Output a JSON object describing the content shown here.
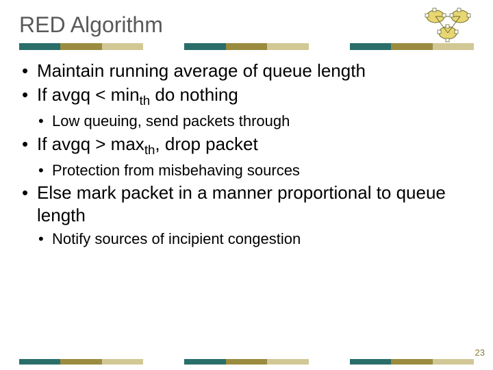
{
  "title": "RED Algorithm",
  "bullets": {
    "b1": "Maintain running average of queue length",
    "b2a": "If avgq < min",
    "b2sub": "th",
    "b2b": " do nothing",
    "b2_1": "Low queuing, send packets through",
    "b3a": "If avgq > max",
    "b3sub": "th",
    "b3b": ", drop packet",
    "b3_1": "Protection from misbehaving sources",
    "b4": "Else mark packet in a manner proportional to queue length",
    "b4_1": "Notify sources of incipient congestion"
  },
  "page_number": "23",
  "stripe_colors": [
    "#2a6e6a",
    "#9a8b3f",
    "#d2c896",
    "#ffffff",
    "#2a6e6a",
    "#9a8b3f",
    "#d2c896",
    "#ffffff",
    "#2a6e6a",
    "#9a8b3f",
    "#d2c896"
  ]
}
